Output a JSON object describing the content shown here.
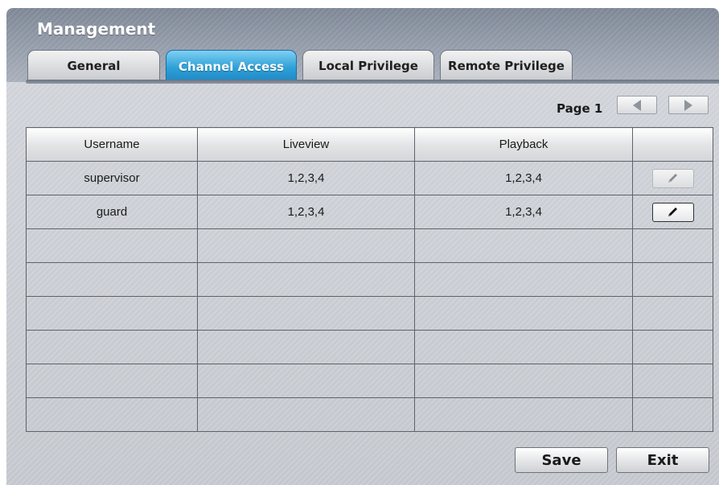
{
  "window": {
    "title": "Management"
  },
  "tabs": [
    {
      "label": "General",
      "active": false
    },
    {
      "label": "Channel Access",
      "active": true
    },
    {
      "label": "Local Privilege",
      "active": false
    },
    {
      "label": "Remote Privilege",
      "active": false
    }
  ],
  "pager": {
    "label": "Page 1",
    "prev_icon": "triangle-left-icon",
    "next_icon": "triangle-right-icon"
  },
  "table": {
    "columns": [
      "Username",
      "Liveview",
      "Playback",
      ""
    ],
    "rows": [
      {
        "username": "supervisor",
        "liveview": "1,2,3,4",
        "playback": "1,2,3,4",
        "edit_icon": "pencil-icon"
      },
      {
        "username": "guard",
        "liveview": "1,2,3,4",
        "playback": "1,2,3,4",
        "edit_icon": "pencil-icon"
      }
    ],
    "empty_rows": 6
  },
  "buttons": {
    "save": "Save",
    "exit": "Exit"
  },
  "colors": {
    "active_tab": "#2ea0d7",
    "titlebar": "#8e96a3"
  }
}
